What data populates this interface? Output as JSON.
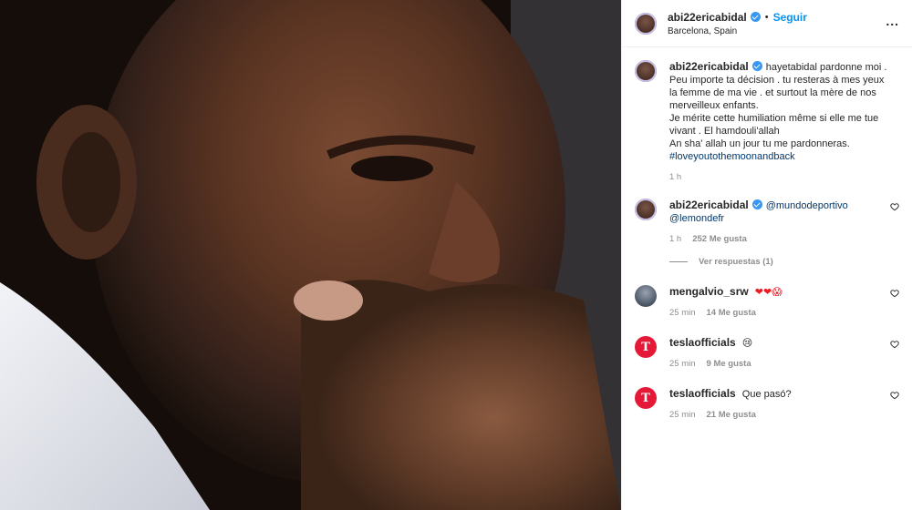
{
  "post": {
    "author": "abi22ericabidal",
    "follow_label": "Seguir",
    "location": "Barcelona, Spain",
    "dot": "•",
    "more_label": "..."
  },
  "comments": [
    {
      "user": "abi22ericabidal",
      "lines": [
        "hayetabidal pardonne moi . Peu importe ta décision . tu resteras à mes yeux la femme de ma vie . et surtout la mère de nos merveilleux enfants.",
        "Je mérite cette humiliation même si elle me tue vivant . El hamdouli'allah",
        "An sha' allah un jour tu me pardonneras."
      ],
      "hashtag": "#loveyoutothemoonandback",
      "time": "1 h"
    },
    {
      "user": "abi22ericabidal",
      "mention1": "@mundodeportivo",
      "mention2": "@lemondefr",
      "time": "1 h",
      "likes": "252 Me gusta",
      "replies": "Ver respuestas (1)"
    },
    {
      "user": "mengalvio_srw",
      "text": "❤❤😱",
      "time": "25 min",
      "likes": "14 Me gusta"
    },
    {
      "user": "teslaofficials",
      "text": "😢",
      "time": "25 min",
      "likes": "9 Me gusta"
    },
    {
      "user": "teslaofficials",
      "text": "Que pasó?",
      "time": "25 min",
      "likes": "21 Me gusta"
    }
  ],
  "icons": {
    "tesla_logo": "T",
    "verified": "verified-badge-icon",
    "heart": "heart-icon"
  },
  "colors": {
    "link": "#0095f6",
    "verified": "#3897f0",
    "tesla": "#e31937"
  }
}
